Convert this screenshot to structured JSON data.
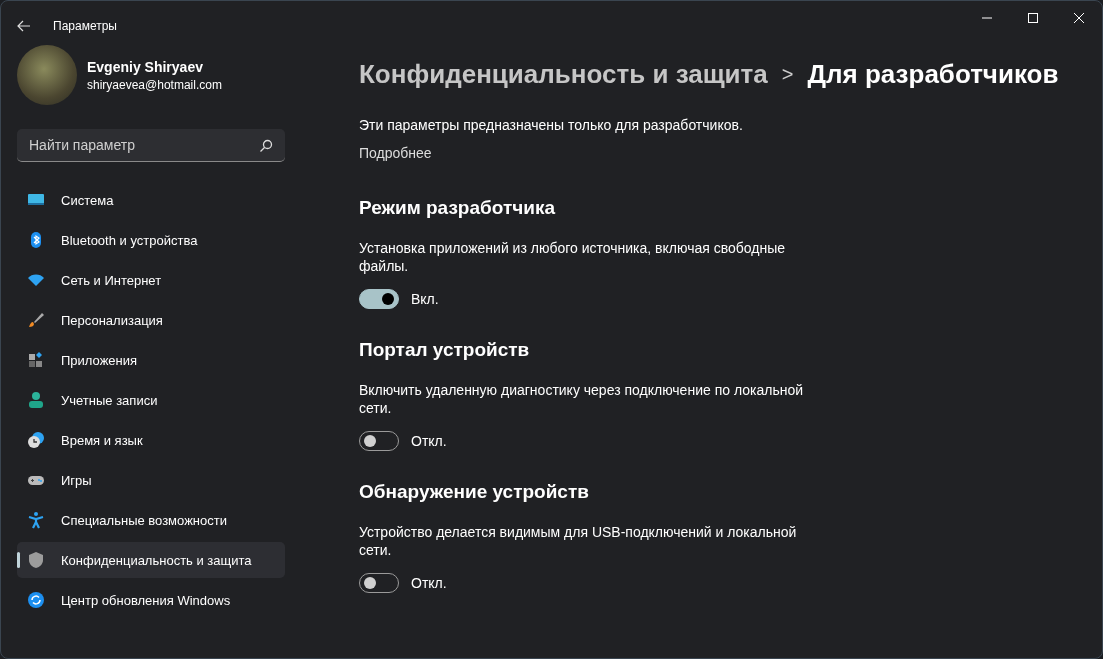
{
  "window": {
    "title": "Параметры"
  },
  "profile": {
    "name": "Evgeniy Shiryaev",
    "email": "shiryaevea@hotmail.com"
  },
  "search": {
    "placeholder": "Найти параметр"
  },
  "sidebar": {
    "items": [
      {
        "label": "Система",
        "selected": false
      },
      {
        "label": "Bluetooth и устройства",
        "selected": false
      },
      {
        "label": "Сеть и Интернет",
        "selected": false
      },
      {
        "label": "Персонализация",
        "selected": false
      },
      {
        "label": "Приложения",
        "selected": false
      },
      {
        "label": "Учетные записи",
        "selected": false
      },
      {
        "label": "Время и язык",
        "selected": false
      },
      {
        "label": "Игры",
        "selected": false
      },
      {
        "label": "Специальные возможности",
        "selected": false
      },
      {
        "label": "Конфиденциальность и защита",
        "selected": true
      },
      {
        "label": "Центр обновления Windows",
        "selected": false
      }
    ]
  },
  "breadcrumb": {
    "parent": "Конфиденциальность и защита",
    "separator": ">",
    "current": "Для разработчиков"
  },
  "intro": "Эти параметры предназначены только для разработчиков.",
  "more_link": "Подробнее",
  "sections": [
    {
      "title": "Режим разработчика",
      "description": "Установка приложений из любого источника, включая свободные файлы.",
      "on": true,
      "state_label": "Вкл."
    },
    {
      "title": "Портал устройств",
      "description": "Включить удаленную диагностику через подключение по локальной сети.",
      "on": false,
      "state_label": "Откл."
    },
    {
      "title": "Обнаружение устройств",
      "description": "Устройство делается видимым для USB-подключений и локальной сети.",
      "on": false,
      "state_label": "Откл."
    }
  ]
}
